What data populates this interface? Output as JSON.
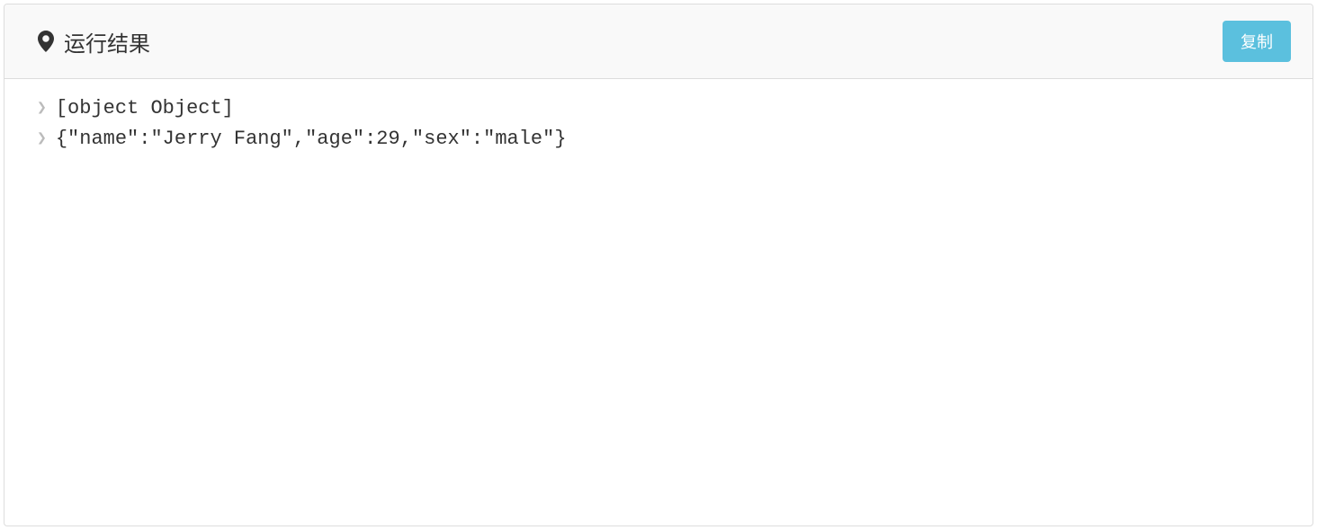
{
  "header": {
    "title": "运行结果",
    "copy_button_label": "复制"
  },
  "output": {
    "lines": [
      "[object Object]",
      "{\"name\":\"Jerry Fang\",\"age\":29,\"sex\":\"male\"}"
    ]
  }
}
